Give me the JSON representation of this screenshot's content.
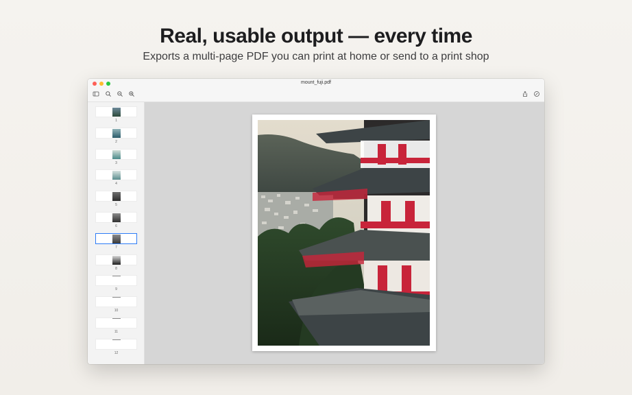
{
  "hero": {
    "headline": "Real, usable output — every time",
    "subline": "Exports a multi-page PDF you can print at home or send to a print shop"
  },
  "window": {
    "title": "mount_fuji.pdf"
  },
  "toolbar": {
    "left_icons": [
      "sidebar-toggle-icon",
      "search-icon",
      "zoom-out-icon",
      "zoom-in-icon"
    ],
    "right_icons": [
      "share-icon",
      "markup-icon"
    ]
  },
  "sidebar": {
    "selected_page": 7,
    "pages": [
      {
        "number": "1"
      },
      {
        "number": "2"
      },
      {
        "number": "3"
      },
      {
        "number": "4"
      },
      {
        "number": "5"
      },
      {
        "number": "6"
      },
      {
        "number": "7"
      },
      {
        "number": "8"
      },
      {
        "number": "9"
      },
      {
        "number": "10"
      },
      {
        "number": "11"
      },
      {
        "number": "12"
      }
    ]
  },
  "colors": {
    "accent": "#2d7cf6",
    "pagoda_red": "#c8243a",
    "roof_dark": "#3d4446"
  }
}
